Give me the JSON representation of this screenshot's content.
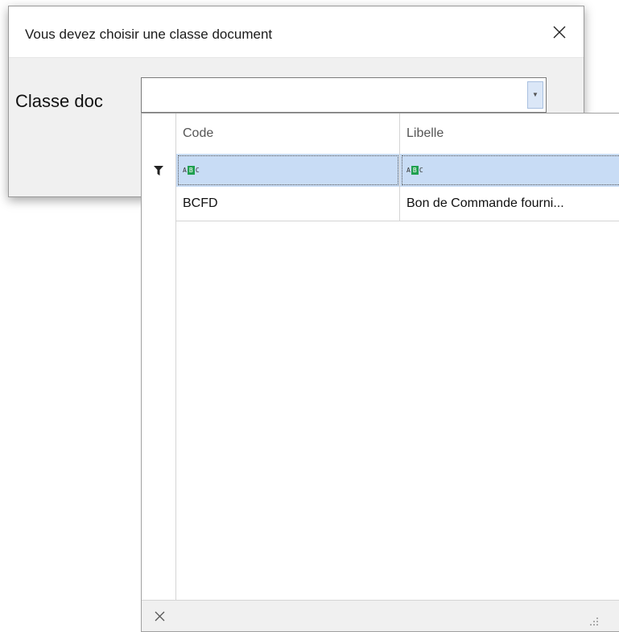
{
  "dialog": {
    "title": "Vous devez choisir une classe document",
    "field_label": "Classe doc",
    "combo_value": ""
  },
  "grid": {
    "columns": [
      "Code",
      "Libelle"
    ],
    "filter_placeholder": "ABC",
    "rows": [
      {
        "code": "BCFD",
        "libelle": "Bon de Commande fourni..."
      }
    ]
  },
  "colors": {
    "filter_highlight": "#c8dcf5",
    "abc_icon": "#20a050",
    "dialog_bg": "#f0f0f0"
  },
  "icons": {
    "close": "close-icon",
    "dropdown": "chevron-down-icon",
    "filter": "filter-icon",
    "clear": "clear-icon",
    "resize": "resize-grip-icon"
  }
}
